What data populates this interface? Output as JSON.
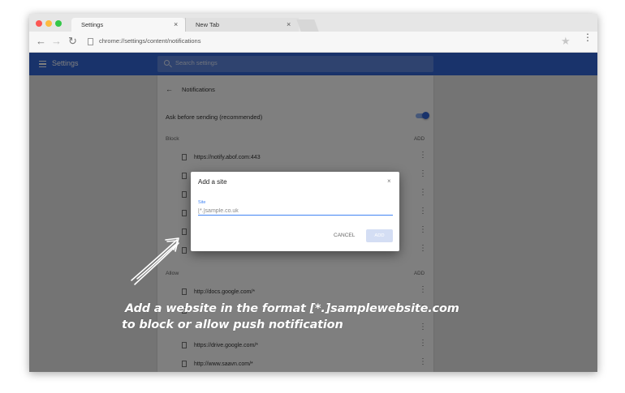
{
  "browser": {
    "window_dots": [
      "#fc5753",
      "#fdbc40",
      "#33c748"
    ],
    "tabs": [
      {
        "title": "Settings",
        "close": "×"
      },
      {
        "title": "New Tab",
        "close": "×"
      }
    ],
    "back_glyph": "←",
    "forward_glyph": "→",
    "reload_glyph": "↻",
    "url": "chrome://settings/content/notifications",
    "star_glyph": "★",
    "menu_glyph": "⋮"
  },
  "settings": {
    "title": "Settings",
    "search_placeholder": "Search settings",
    "page_title": "Notifications",
    "back_glyph": "←",
    "ask_label": "Ask before sending (recommended)",
    "ask_enabled": true,
    "accent": "#3367d6",
    "block": {
      "heading": "Block",
      "add_label": "ADD",
      "items": [
        {
          "site": "https://notify.abof.com:443"
        },
        {
          "site": ""
        },
        {
          "site": ""
        },
        {
          "site": ""
        },
        {
          "site": ""
        },
        {
          "site": ""
        }
      ]
    },
    "allow": {
      "heading": "Allow",
      "add_label": "ADD",
      "items": [
        {
          "site": "http://docs.google.com/*"
        },
        {
          "site": ""
        },
        {
          "site": ""
        },
        {
          "site": "https://drive.google.com/*"
        },
        {
          "site": "http://www.saavn.com/*"
        }
      ]
    },
    "row_menu_glyph": "⋮"
  },
  "dialog": {
    "title": "Add a site",
    "close_glyph": "×",
    "field_label": "Site",
    "field_placeholder": "[*.]sample.co.uk",
    "cancel_label": "CANCEL",
    "add_label": "ADD"
  },
  "annotation": {
    "line1": "Add a website in the format [*.]samplewebsite.com",
    "line2": "to block or allow push notification"
  }
}
